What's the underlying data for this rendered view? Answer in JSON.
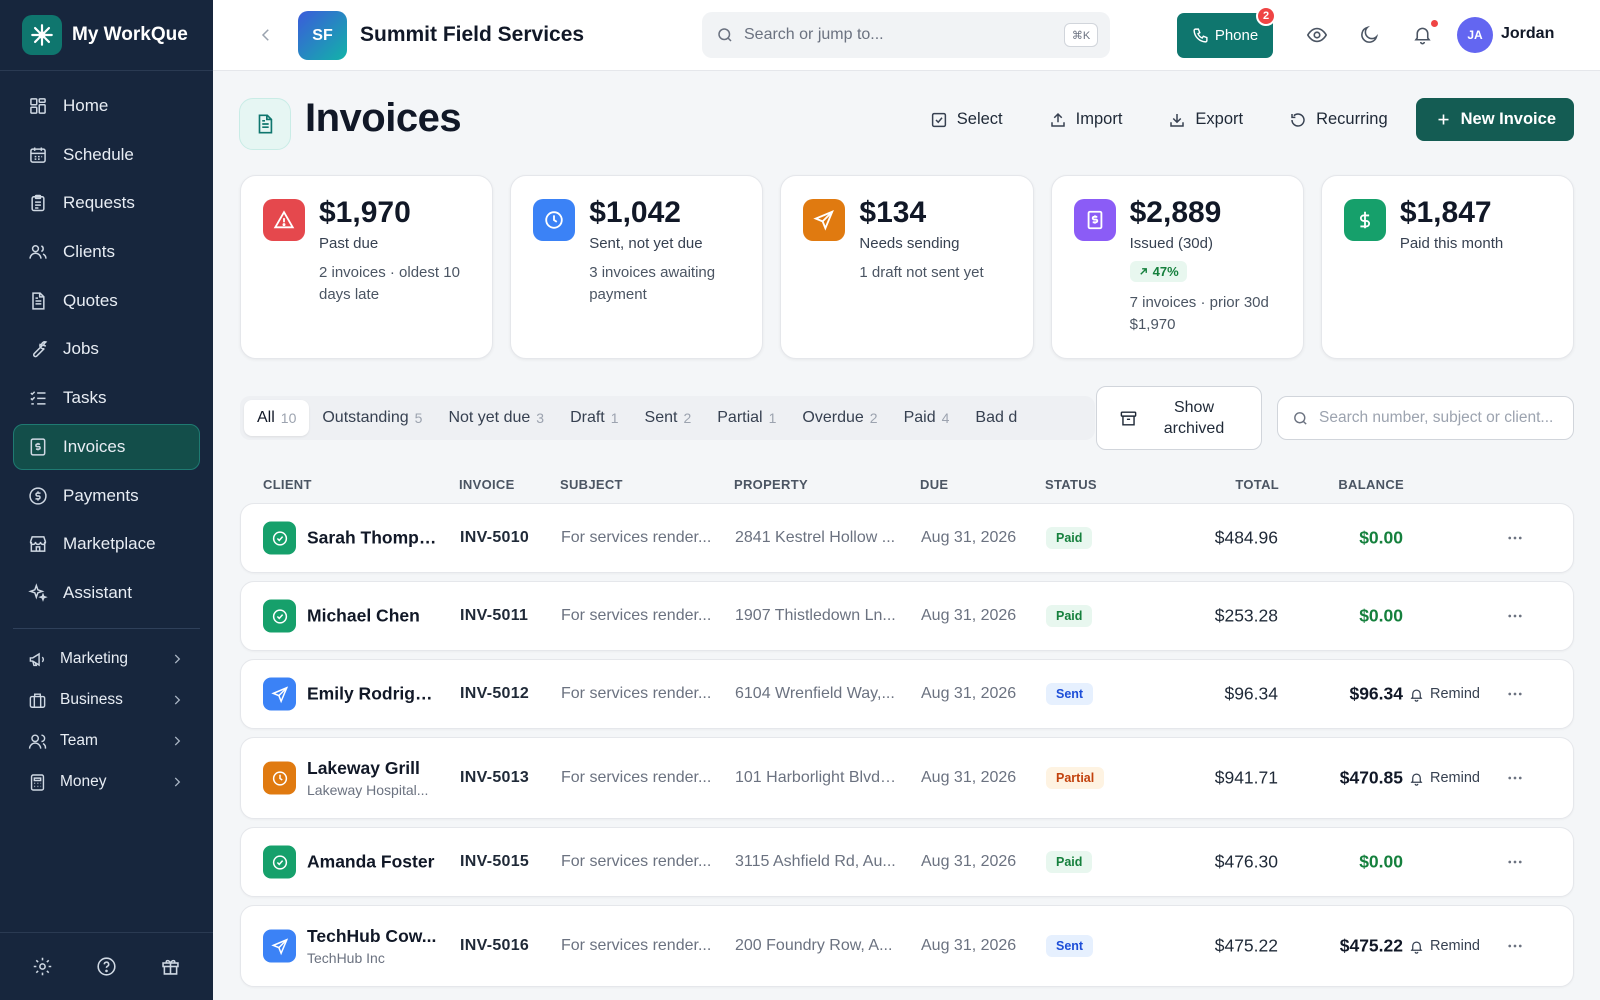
{
  "app": {
    "name": "My WorkQue"
  },
  "sidebar": {
    "items": [
      {
        "label": "Home",
        "icon": "home-grid-icon"
      },
      {
        "label": "Schedule",
        "icon": "calendar-icon"
      },
      {
        "label": "Requests",
        "icon": "clipboard-icon"
      },
      {
        "label": "Clients",
        "icon": "users-icon"
      },
      {
        "label": "Quotes",
        "icon": "document-icon"
      },
      {
        "label": "Jobs",
        "icon": "wrench-icon"
      },
      {
        "label": "Tasks",
        "icon": "checklist-icon"
      },
      {
        "label": "Invoices",
        "icon": "invoice-icon",
        "active": true
      },
      {
        "label": "Payments",
        "icon": "dollar-circle-icon"
      },
      {
        "label": "Marketplace",
        "icon": "store-icon"
      },
      {
        "label": "Assistant",
        "icon": "sparkle-icon"
      }
    ],
    "groups": [
      {
        "label": "Marketing",
        "icon": "megaphone-icon"
      },
      {
        "label": "Business",
        "icon": "briefcase-icon"
      },
      {
        "label": "Team",
        "icon": "user-icon"
      },
      {
        "label": "Money",
        "icon": "calculator-icon"
      }
    ]
  },
  "topbar": {
    "company_initials": "SF",
    "company_name": "Summit Field Services",
    "search_placeholder": "Search or jump to...",
    "search_shortcut": "⌘K",
    "phone_label": "Phone",
    "phone_badge": "2",
    "user_initials": "JA",
    "user_name": "Jordan"
  },
  "page": {
    "title": "Invoices",
    "actions": {
      "select": "Select",
      "import": "Import",
      "export": "Export",
      "recurring": "Recurring",
      "new_invoice": "New Invoice"
    }
  },
  "kpis": [
    {
      "value": "$1,970",
      "label": "Past due",
      "note": "2 invoices · oldest 10 days late",
      "color": "#e5484d",
      "icon": "warning-icon"
    },
    {
      "value": "$1,042",
      "label": "Sent, not yet due",
      "note": "3 invoices awaiting payment",
      "color": "#3b82f6",
      "icon": "clock-icon"
    },
    {
      "value": "$134",
      "label": "Needs sending",
      "note": "1 draft not sent yet",
      "color": "#e07a10",
      "icon": "send-icon"
    },
    {
      "value": "$2,889",
      "label": "Issued (30d)",
      "trend": "47%",
      "note": "7 invoices · prior 30d $1,970",
      "color": "#8b5cf6",
      "icon": "receipt-icon"
    },
    {
      "value": "$1,847",
      "label": "Paid this month",
      "note": "",
      "color": "#16a06b",
      "icon": "dollar-icon"
    }
  ],
  "filters": {
    "tabs": [
      {
        "label": "All",
        "count": "10",
        "active": true
      },
      {
        "label": "Outstanding",
        "count": "5"
      },
      {
        "label": "Not yet due",
        "count": "3"
      },
      {
        "label": "Draft",
        "count": "1"
      },
      {
        "label": "Sent",
        "count": "2"
      },
      {
        "label": "Partial",
        "count": "1"
      },
      {
        "label": "Overdue",
        "count": "2"
      },
      {
        "label": "Paid",
        "count": "4"
      },
      {
        "label": "Bad d",
        "count": ""
      }
    ],
    "show_archived": "Show archived",
    "search_placeholder": "Search number, subject or client..."
  },
  "table": {
    "columns": {
      "client": "CLIENT",
      "invoice": "INVOICE",
      "subject": "SUBJECT",
      "property": "PROPERTY",
      "due": "DUE",
      "status": "STATUS",
      "total": "TOTAL",
      "balance": "BALANCE"
    },
    "remind_label": "Remind",
    "rows": [
      {
        "client": "Sarah Thomps...",
        "sub": "",
        "invoice": "INV-5010",
        "subject": "For services render...",
        "property": "2841 Kestrel Hollow ...",
        "due": "Aug 31, 2026",
        "status": "Paid",
        "total": "$484.96",
        "balance": "$0.00",
        "remind": false
      },
      {
        "client": "Michael Chen",
        "sub": "",
        "invoice": "INV-5011",
        "subject": "For services render...",
        "property": "1907 Thistledown Ln...",
        "due": "Aug 31, 2026",
        "status": "Paid",
        "total": "$253.28",
        "balance": "$0.00",
        "remind": false
      },
      {
        "client": "Emily Rodriguez",
        "sub": "",
        "invoice": "INV-5012",
        "subject": "For services render...",
        "property": "6104 Wrenfield Way,...",
        "due": "Aug 31, 2026",
        "status": "Sent",
        "total": "$96.34",
        "balance": "$96.34",
        "remind": true
      },
      {
        "client": "Lakeway Grill",
        "sub": "Lakeway Hospital...",
        "invoice": "INV-5013",
        "subject": "For services render...",
        "property": "101 Harborlight Blvd,...",
        "due": "Aug 31, 2026",
        "status": "Partial",
        "total": "$941.71",
        "balance": "$470.85",
        "remind": true
      },
      {
        "client": "Amanda Foster",
        "sub": "",
        "invoice": "INV-5015",
        "subject": "For services render...",
        "property": "3115 Ashfield Rd, Au...",
        "due": "Aug 31, 2026",
        "status": "Paid",
        "total": "$476.30",
        "balance": "$0.00",
        "remind": false
      },
      {
        "client": "TechHub Cow...",
        "sub": "TechHub Inc",
        "invoice": "INV-5016",
        "subject": "For services render...",
        "property": "200 Foundry Row, A...",
        "due": "Aug 31, 2026",
        "status": "Sent",
        "total": "$475.22",
        "balance": "$475.22",
        "remind": true
      }
    ]
  }
}
